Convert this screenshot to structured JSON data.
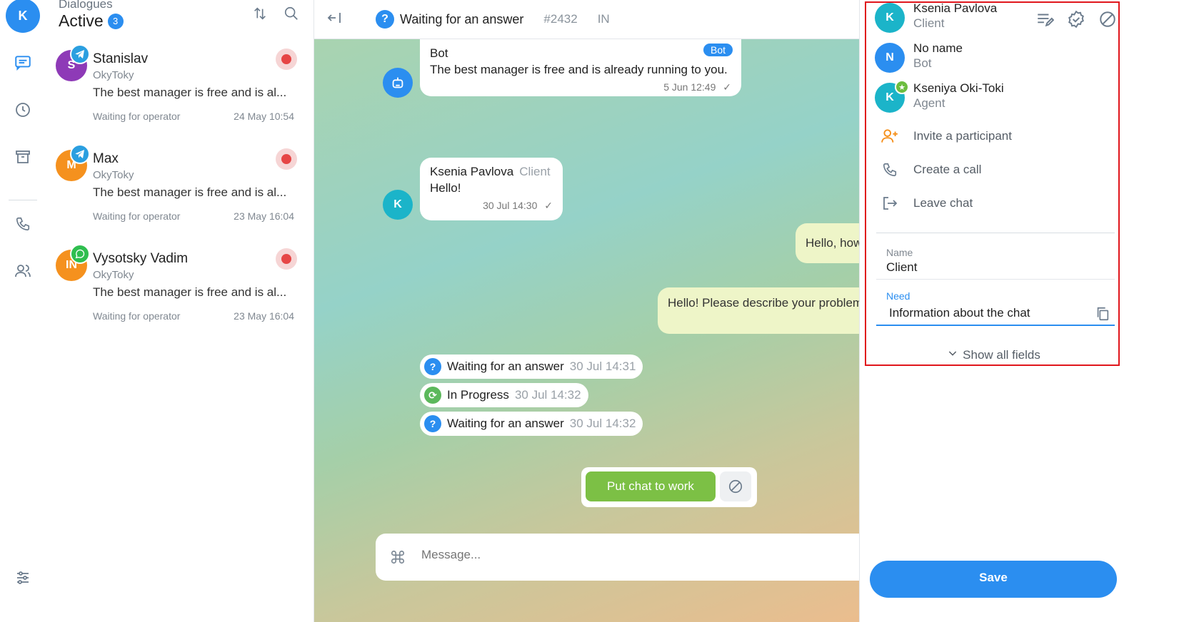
{
  "user": {
    "initial": "K"
  },
  "list": {
    "subtitle": "Dialogues",
    "title": "Active",
    "count": "3",
    "dialogs": [
      {
        "initial": "S",
        "color": "#8e3ab7",
        "channel": "telegram",
        "name": "Stanislav",
        "source": "OkyToky",
        "preview": "The best manager is free and is al...",
        "status": "Waiting for operator",
        "date": "24 May 10:54"
      },
      {
        "initial": "M",
        "color": "#f5911e",
        "channel": "telegram",
        "name": "Max",
        "source": "OkyToky",
        "preview": "The best manager is free and is al...",
        "status": "Waiting for operator",
        "date": "23 May 16:04"
      },
      {
        "initial": "IN",
        "color": "#f5911e",
        "channel": "whatsapp",
        "name": "Vysotsky Vadim",
        "source": "OkyToky",
        "preview": "The best manager is free and is al...",
        "status": "Waiting for operator",
        "date": "23 May 16:04"
      }
    ]
  },
  "chat": {
    "status": "Waiting for an answer",
    "id": "#2432",
    "direction": "IN",
    "messages": {
      "bot": {
        "sender": "Bot",
        "tag": "Bot",
        "text": "The best manager is free and is already running to you.",
        "time": "5 Jun 12:49"
      },
      "client": {
        "sender": "Ksenia Pavlova",
        "role": "Client",
        "text": "Hello!",
        "time": "30 Jul 14:30",
        "initial": "K"
      },
      "out1": "Hello, how",
      "out2": "Hello! Please describe your problem"
    },
    "events": [
      {
        "label": "Waiting for an answer",
        "time": "30 Jul 14:31",
        "kind": "question"
      },
      {
        "label": "In Progress",
        "time": "30 Jul 14:32",
        "kind": "progress"
      },
      {
        "label": "Waiting for an answer",
        "time": "30 Jul 14:32",
        "kind": "question"
      }
    ],
    "work_button": "Put chat to work",
    "composer_placeholder": "Message..."
  },
  "panel": {
    "participants": [
      {
        "initial": "K",
        "color": "#1bb4c9",
        "name": "Ksenia Pavlova",
        "role": "Client"
      },
      {
        "initial": "N",
        "color": "#2b8ef0",
        "name": "No name",
        "role": "Bot"
      },
      {
        "initial": "K",
        "color": "#1bb4c9",
        "name": "Kseniya Oki-Toki",
        "role": "Agent"
      }
    ],
    "actions": {
      "invite": "Invite a participant",
      "call": "Create a call",
      "leave": "Leave chat"
    },
    "fields": {
      "name_label": "Name",
      "name_value": "Client",
      "need_label": "Need",
      "need_value": "Information about the chat"
    },
    "show_all": "Show all fields",
    "save": "Save"
  },
  "colors": {
    "accent": "#2b8ef0",
    "success": "#7cc045",
    "danger": "#e64545",
    "highlight": "#e0161c"
  }
}
